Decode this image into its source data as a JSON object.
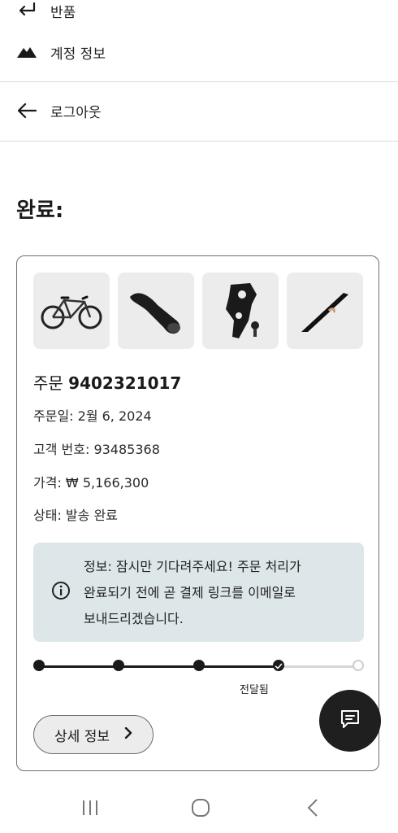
{
  "menu": {
    "return_label": "반품",
    "account_label": "계정 정보",
    "logout_label": "로그아웃"
  },
  "section": {
    "title": "완료:"
  },
  "order": {
    "title_prefix": "주문",
    "number": "9402321017",
    "date_line": "주문일: 2월 6, 2024",
    "customer_line": "고객 번호: 93485368",
    "price_line": "가격: ₩ 5,166,300",
    "status_line": "상태: 발송 완료",
    "thumbnails": [
      "bicycle",
      "stem-mount",
      "derailleur-hanger",
      "chain-guide"
    ]
  },
  "notice": {
    "icon": "info-icon",
    "lines": [
      "정보: 잠시만 기다려주세요! 주문 처리가",
      "완료되기 전에 곧 결제 링크를 이메일로",
      "보내드리겠습니다."
    ]
  },
  "progress": {
    "steps_total": 5,
    "steps_completed": 4,
    "current_label": "전달됨"
  },
  "buttons": {
    "details_label": "상세 정보"
  },
  "colors": {
    "notice_bg": "#dde7e9",
    "progress_done": "#1a1a1a",
    "progress_pending": "#d6d6d6",
    "fab_bg": "#1f1f1f"
  }
}
